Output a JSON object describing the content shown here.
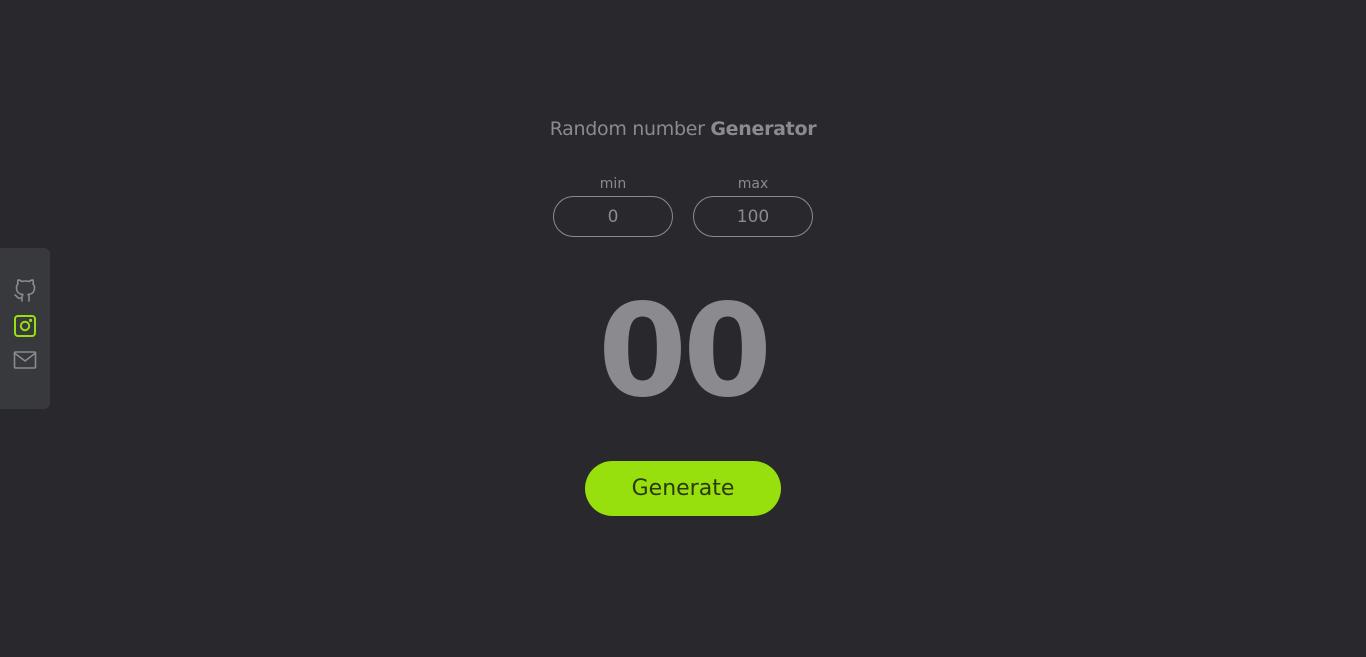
{
  "header": {
    "title_regular": "Random number ",
    "title_bold": "Generator"
  },
  "inputs": {
    "min": {
      "label": "min",
      "value": "0"
    },
    "max": {
      "label": "max",
      "value": "100"
    }
  },
  "result": {
    "value": "00"
  },
  "generate_button": {
    "label": "Generate"
  },
  "social": {
    "items": [
      {
        "icon": "github-icon",
        "color": "#8a8a8f"
      },
      {
        "icon": "instagram-icon",
        "color": "#97e00d"
      },
      {
        "icon": "mail-icon",
        "color": "#8a8a8f"
      }
    ]
  },
  "colors": {
    "background": "#29282d",
    "accent": "#97e00d",
    "text_muted": "#8a8a8f",
    "sidebar": "#38393d"
  }
}
